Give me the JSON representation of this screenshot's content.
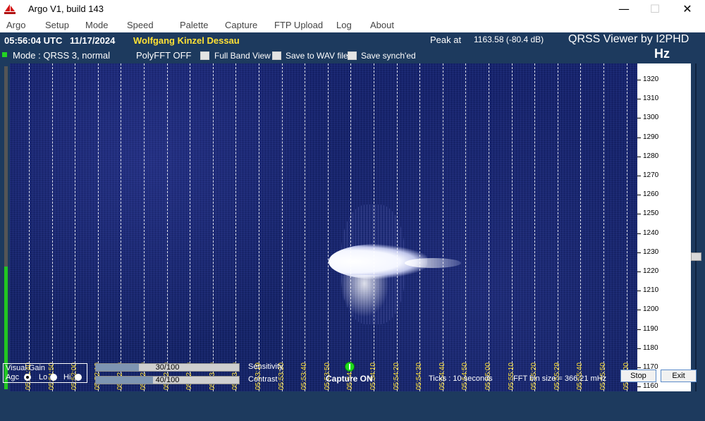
{
  "window": {
    "title": "Argo V1, build 143",
    "minimize_glyph": "—",
    "maximize_glyph": "☐",
    "close_glyph": "✕"
  },
  "menu": [
    "Argo",
    "Setup",
    "Mode",
    "Speed",
    "Palette",
    "Capture",
    "FTP Upload",
    "Log",
    "About"
  ],
  "header": {
    "time": "05:56:04 UTC",
    "date": "11/17/2024",
    "operator": "Wolfgang Kinzel Dessau",
    "peak_label": "Peak at",
    "peak_value": "1163.58 (-80.4 dB)",
    "viewer": "QRSS Viewer by I2PHD",
    "unit": "Hz"
  },
  "status": {
    "mode": "Mode : QRSS 3, normal",
    "polyfft": "PolyFFT OFF",
    "checkboxes": [
      {
        "label": "Full Band View",
        "checked": false
      },
      {
        "label": "Save to WAV file",
        "checked": false
      },
      {
        "label": "Save synch'ed",
        "checked": false
      }
    ]
  },
  "waterfall": {
    "time_labels": [
      "05:51:40",
      "05:51:50",
      "05:52:00",
      "05:52:10",
      "05:52:20",
      "05:52:30",
      "05:52:40",
      "05:52:50",
      "05:53:00",
      "05:53:10",
      "05:53:19",
      "05:53:30",
      "05:53:40",
      "05:53:50",
      "05:54:00",
      "05:54:10",
      "05:54:20",
      "05:54:30",
      "05:54:40",
      "05:54:50",
      "05:55:00",
      "05:55:10",
      "05:55:20",
      "05:55:29",
      "05:55:40",
      "05:55:50",
      "05:56:00"
    ],
    "freq_labels": [
      "1320",
      "1310",
      "1300",
      "1290",
      "1280",
      "1270",
      "1260",
      "1250",
      "1240",
      "1230",
      "1220",
      "1210",
      "1200",
      "1190",
      "1180",
      "1170",
      "1160"
    ]
  },
  "colors": {
    "panel_bg": "#1d3a5e",
    "waterfall_bg": "#142066",
    "operator_text": "#ffe135",
    "led_green": "#1edc1e"
  },
  "bottom": {
    "visual_gain_title": "Visual Gain",
    "gain_options": [
      {
        "label": "Agc",
        "selected": true
      },
      {
        "label": "Lo",
        "selected": false
      },
      {
        "label": "Hi",
        "selected": false
      }
    ],
    "sensitivity": {
      "value": "30/100",
      "fraction": 0.3,
      "label": "Sensitivity"
    },
    "contrast": {
      "value": "40/100",
      "fraction": 0.4,
      "label": "Contrast"
    },
    "capture": "Capture ON",
    "ticks": "Ticks    : 10 seconds",
    "fft": "FFT bin size = 366.21 mHz",
    "stop_label": "Stop",
    "exit_label": "Exit"
  },
  "left_gauge_level": 0.38
}
